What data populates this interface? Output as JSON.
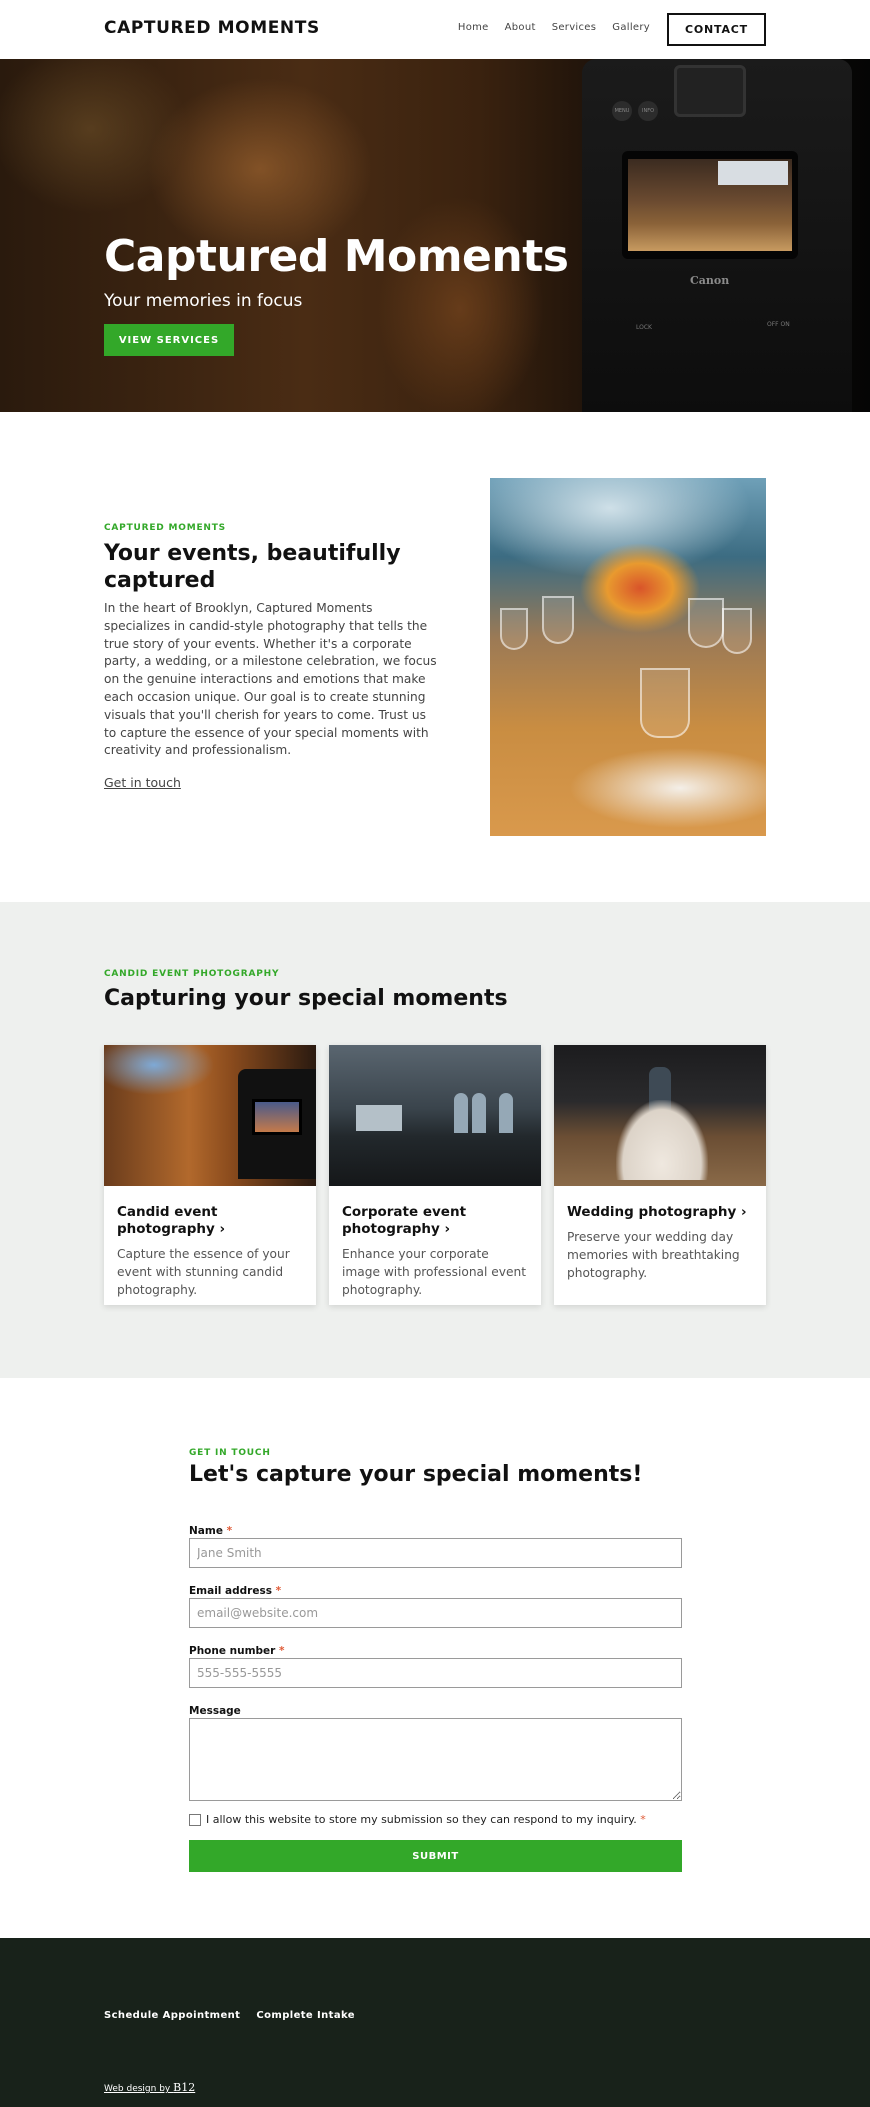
{
  "header": {
    "logo": "CAPTURED MOMENTS",
    "nav": [
      "Home",
      "About",
      "Services",
      "Gallery"
    ],
    "contact_label": "CONTACT"
  },
  "hero": {
    "title": "Captured Moments",
    "subtitle": "Your memories in focus",
    "button_label": "VIEW SERVICES",
    "camera": {
      "brand": "Canon",
      "menu_label": "MENU",
      "info_label": "INFO",
      "lock_label": "LOCK",
      "switch_label": "OFF  ON"
    }
  },
  "about": {
    "eyebrow": "CAPTURED MOMENTS",
    "heading": "Your events, beautifully captured",
    "body": "In the heart of Brooklyn, Captured Moments specializes in candid-style photography that tells the true story of your events. Whether it's a corporate party, a wedding, or a milestone celebration, we focus on the genuine interactions and emotions that make each occasion unique. Our goal is to create stunning visuals that you'll cherish for years to come. Trust us to capture the essence of your special moments with creativity and professionalism.",
    "link_label": "Get in touch",
    "image_alt": "Table setting with flower centerpiece and wine glasses"
  },
  "services": {
    "eyebrow": "CANDID EVENT PHOTOGRAPHY",
    "heading": "Capturing your special moments",
    "cards": [
      {
        "title": "Candid event photography",
        "chevron": "›",
        "description": "Capture the essence of your event with stunning candid photography."
      },
      {
        "title": "Corporate event photography",
        "chevron": "›",
        "description": "Enhance your corporate image with professional event photography."
      },
      {
        "title": "Wedding photography",
        "chevron": "›",
        "description": "Preserve your wedding day memories with breathtaking photography."
      }
    ]
  },
  "contact": {
    "eyebrow": "GET IN TOUCH",
    "heading": "Let's capture your special moments!",
    "fields": {
      "name": {
        "label": "Name",
        "required_mark": "*",
        "placeholder": "Jane Smith",
        "value": ""
      },
      "email": {
        "label": "Email address",
        "required_mark": "*",
        "placeholder": "email@website.com",
        "value": ""
      },
      "phone": {
        "label": "Phone number",
        "required_mark": "*",
        "placeholder": "555-555-5555",
        "value": ""
      },
      "message": {
        "label": "Message",
        "value": ""
      }
    },
    "consent": {
      "label": "I allow this website to store my submission so they can respond to my inquiry.",
      "required_mark": "*",
      "checked": false
    },
    "submit_label": "SUBMIT"
  },
  "footer": {
    "links": [
      "Schedule Appointment",
      "Complete Intake"
    ],
    "credit_prefix": "Web design by ",
    "credit_brand": "B12"
  },
  "colors": {
    "accent": "#33a829",
    "required": "#e05a36",
    "services_bg": "#eef0ee",
    "footer_bg": "#18221a"
  }
}
